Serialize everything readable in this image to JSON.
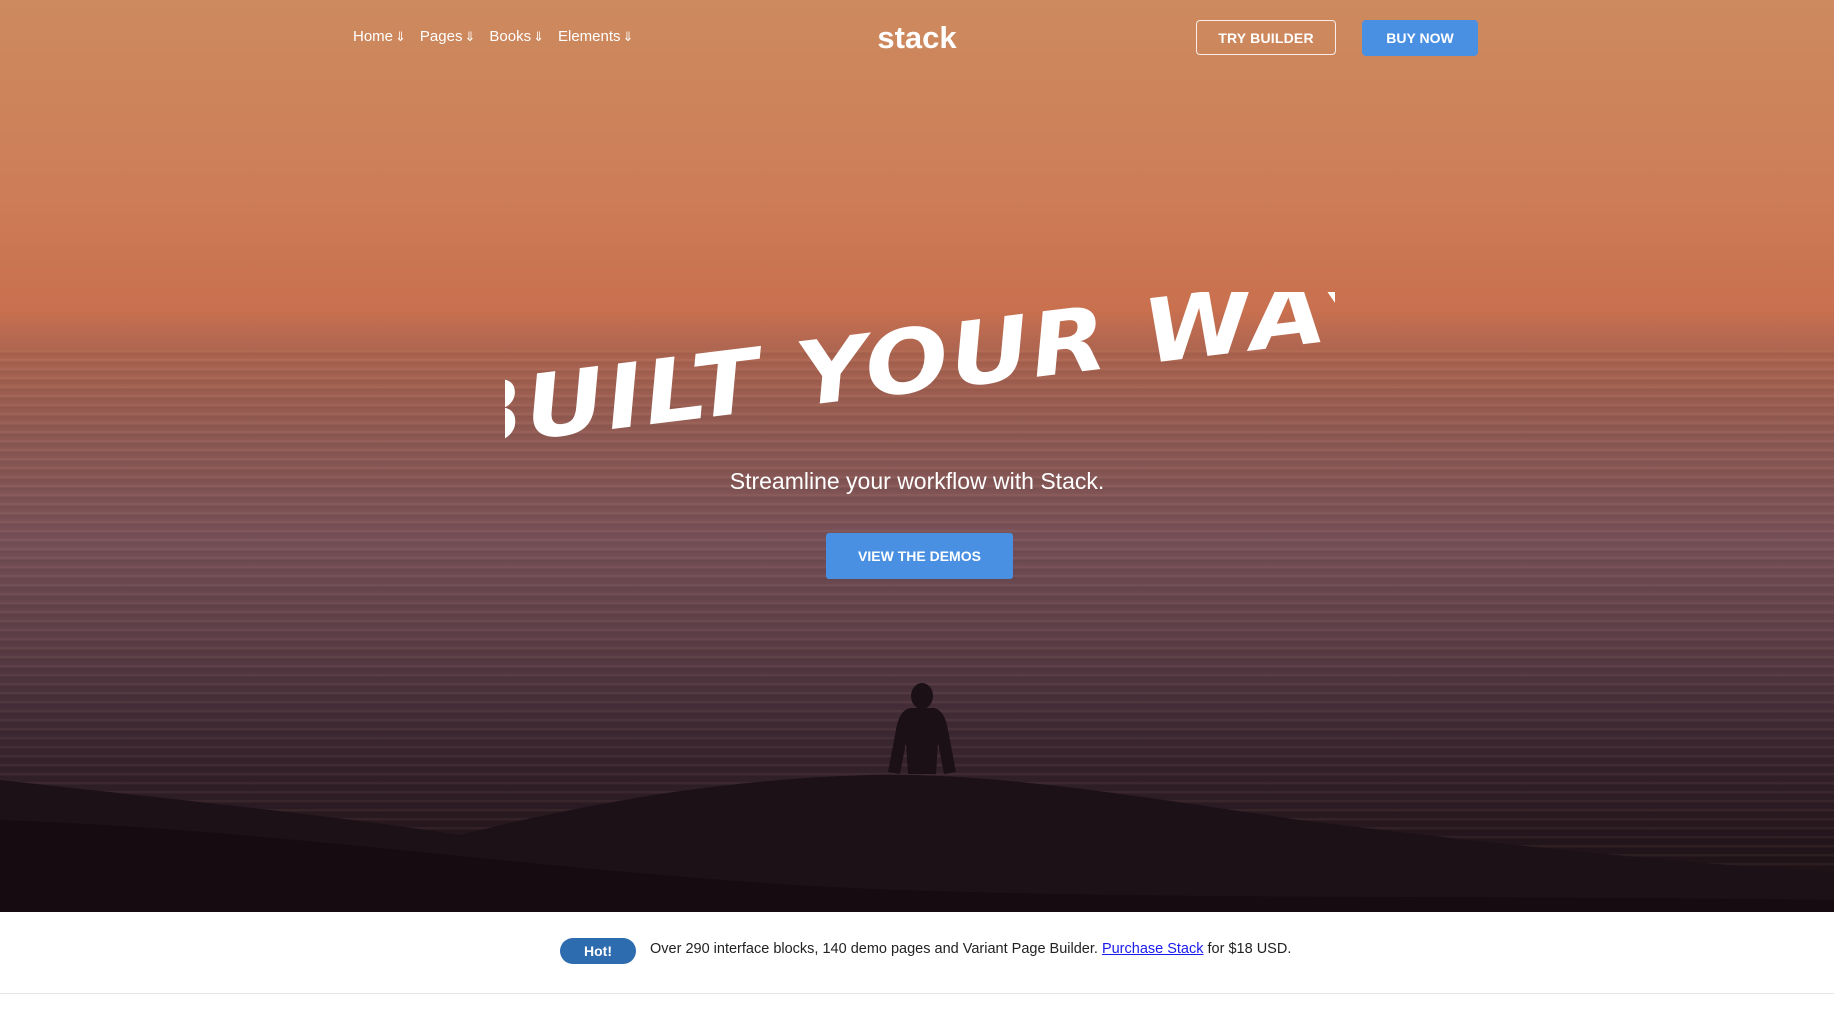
{
  "nav": {
    "items": [
      {
        "label": "Home",
        "arrow": "⇓"
      },
      {
        "label": "Pages",
        "arrow": "⇓"
      },
      {
        "label": "Books",
        "arrow": "⇓"
      },
      {
        "label": "Elements",
        "arrow": "⇓"
      }
    ]
  },
  "brand": {
    "logo": "stack"
  },
  "header": {
    "try_label": "TRY BUILDER",
    "buy_label": "BUY NOW"
  },
  "hero": {
    "headline": "Built your way",
    "tagline": "Streamline your workflow with Stack.",
    "cta_label": "VIEW THE DEMOS"
  },
  "notice": {
    "badge": "Hot!",
    "text_before": "Over 290 interface blocks, 140 demo pages and Variant Page Builder.",
    "link": "Purchase Stack",
    "text_after": "for $18 USD."
  },
  "colors": {
    "accent": "#4a90e2",
    "badge": "#2d6cae",
    "link": "#1a1aee"
  }
}
